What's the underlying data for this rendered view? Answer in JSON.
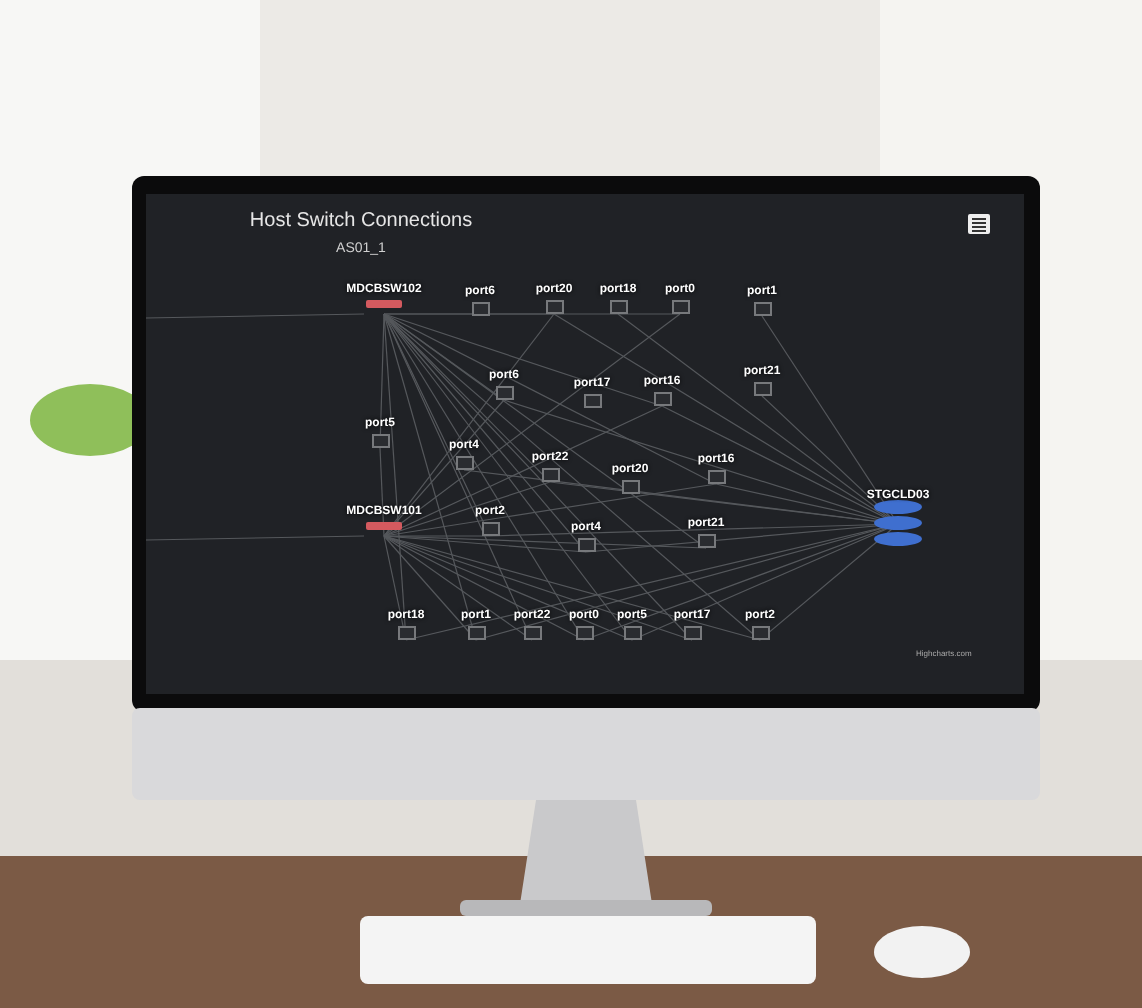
{
  "chart": {
    "title": "Host Switch Connections",
    "subtitle": "AS01_1",
    "credit": "Highcharts.com",
    "nodes": [
      {
        "label": "MDCBSW102",
        "kind": "switch"
      },
      {
        "label": "port6",
        "kind": "port"
      },
      {
        "label": "port20",
        "kind": "port"
      },
      {
        "label": "port18",
        "kind": "port"
      },
      {
        "label": "port0",
        "kind": "port"
      },
      {
        "label": "port1",
        "kind": "port"
      },
      {
        "label": "port6",
        "kind": "port"
      },
      {
        "label": "port17",
        "kind": "port"
      },
      {
        "label": "port16",
        "kind": "port"
      },
      {
        "label": "port21",
        "kind": "port"
      },
      {
        "label": "port5",
        "kind": "port"
      },
      {
        "label": "port4",
        "kind": "port"
      },
      {
        "label": "port22",
        "kind": "port"
      },
      {
        "label": "port20",
        "kind": "port"
      },
      {
        "label": "port16",
        "kind": "port"
      },
      {
        "label": "STGCLD03",
        "kind": "storage"
      },
      {
        "label": "MDCBSW101",
        "kind": "switch"
      },
      {
        "label": "port2",
        "kind": "port"
      },
      {
        "label": "port4",
        "kind": "port"
      },
      {
        "label": "port21",
        "kind": "port"
      },
      {
        "label": "port18",
        "kind": "port"
      },
      {
        "label": "port1",
        "kind": "port"
      },
      {
        "label": "port22",
        "kind": "port"
      },
      {
        "label": "port0",
        "kind": "port"
      },
      {
        "label": "port5",
        "kind": "port"
      },
      {
        "label": "port17",
        "kind": "port"
      },
      {
        "label": "port2",
        "kind": "port"
      }
    ]
  }
}
